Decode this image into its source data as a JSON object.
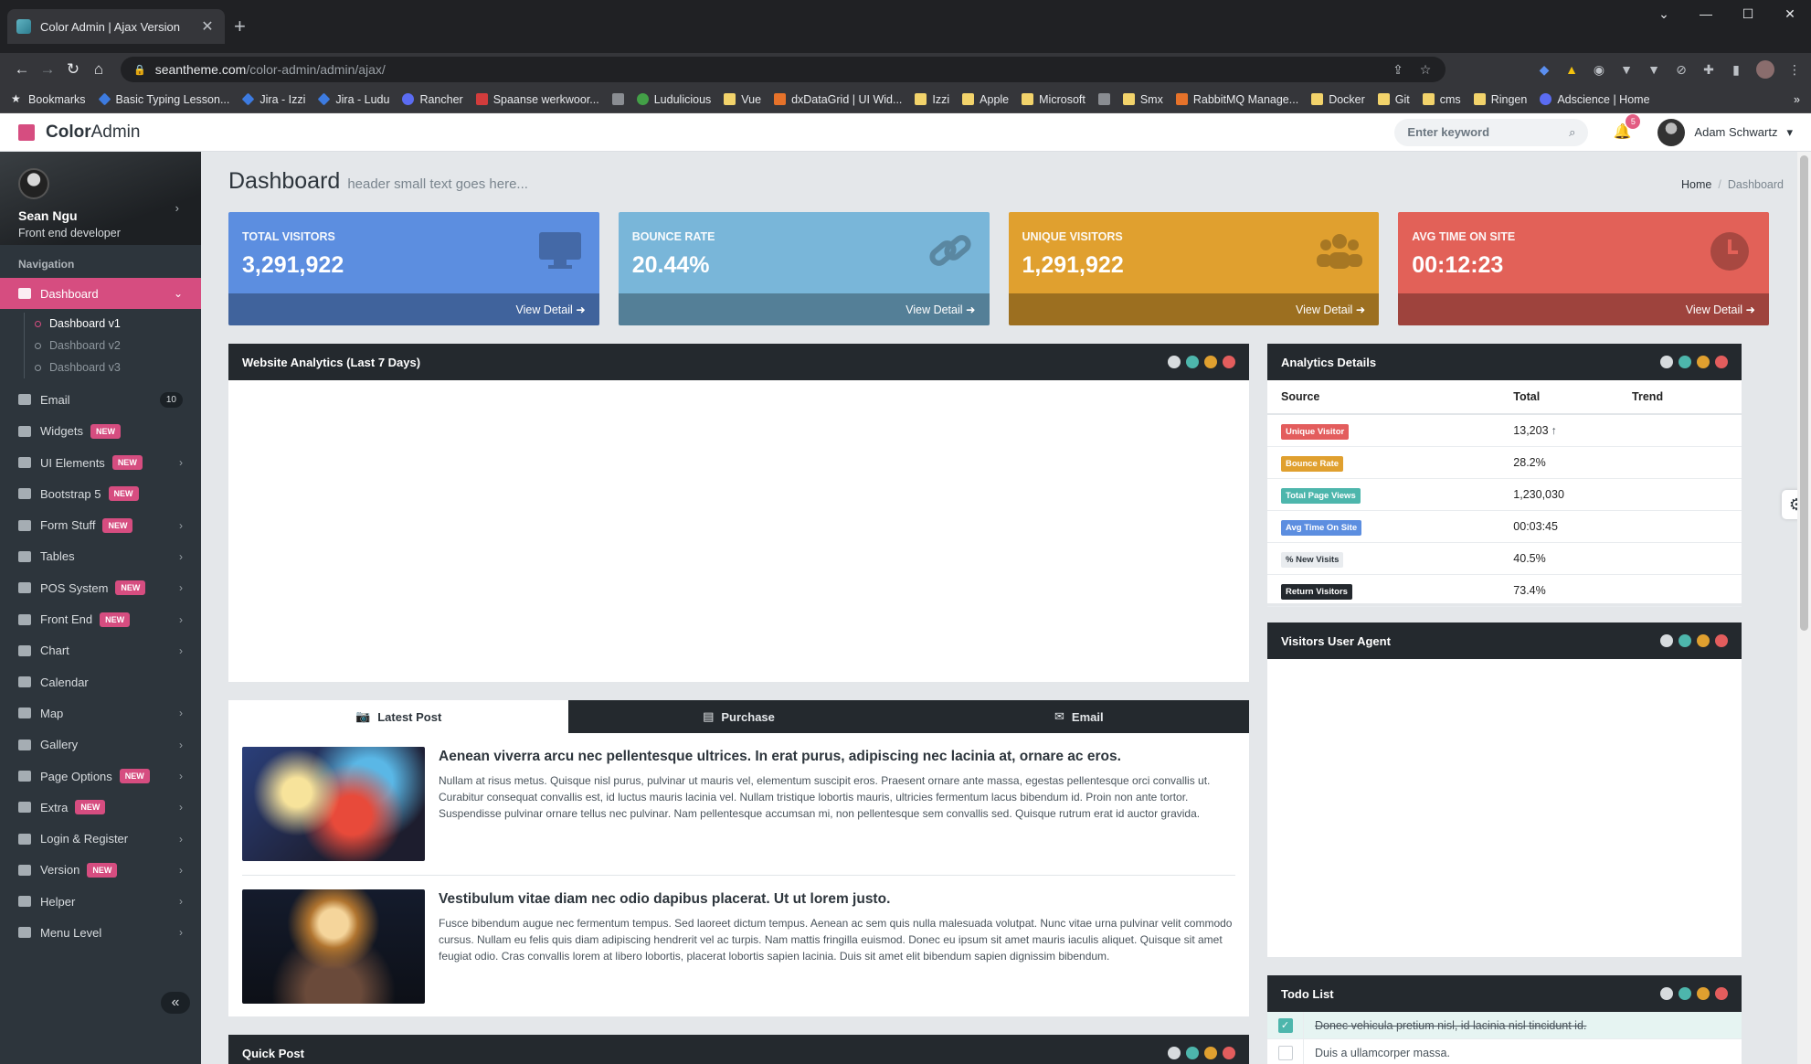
{
  "browser": {
    "tab_title": "Color Admin | Ajax Version",
    "url_host": "seantheme.com",
    "url_path": "/color-admin/admin/ajax/",
    "bookmarks": [
      {
        "label": "Bookmarks",
        "icon": "star-icon"
      },
      {
        "label": "Basic Typing Lesson...",
        "icon": "blue"
      },
      {
        "label": "Jira - Izzi",
        "icon": "blue"
      },
      {
        "label": "Jira - Ludu",
        "icon": "blue"
      },
      {
        "label": "Rancher",
        "icon": "purple"
      },
      {
        "label": "Spaanse werkwoor...",
        "icon": "red"
      },
      {
        "label": "",
        "icon": "gray"
      },
      {
        "label": "Ludulicious",
        "icon": "green"
      },
      {
        "label": "Vue",
        "icon": "folder"
      },
      {
        "label": "dxDataGrid | UI Wid...",
        "icon": "orange"
      },
      {
        "label": "Izzi",
        "icon": "folder"
      },
      {
        "label": "Apple",
        "icon": "folder"
      },
      {
        "label": "Microsoft",
        "icon": "folder"
      },
      {
        "label": "",
        "icon": "gray"
      },
      {
        "label": "Smx",
        "icon": "folder"
      },
      {
        "label": "RabbitMQ Manage...",
        "icon": "orange"
      },
      {
        "label": "Docker",
        "icon": "folder"
      },
      {
        "label": "Git",
        "icon": "folder"
      },
      {
        "label": "cms",
        "icon": "folder"
      },
      {
        "label": "Ringen",
        "icon": "folder"
      },
      {
        "label": "Adscience | Home",
        "icon": "purple"
      }
    ]
  },
  "topbar": {
    "brand_bold": "Color",
    "brand_rest": "Admin",
    "search_placeholder": "Enter keyword",
    "notif_count": "5",
    "user_name": "Adam Schwartz"
  },
  "sidebar": {
    "profile_name": "Sean Ngu",
    "profile_role": "Front end developer",
    "nav_header": "Navigation",
    "items": [
      {
        "label": "Dashboard",
        "active": true
      },
      {
        "label": "Email",
        "count": "10"
      },
      {
        "label": "Widgets",
        "badge": "NEW"
      },
      {
        "label": "UI Elements",
        "badge": "NEW",
        "caret": true
      },
      {
        "label": "Bootstrap 5",
        "badge": "NEW"
      },
      {
        "label": "Form Stuff",
        "badge": "NEW",
        "caret": true
      },
      {
        "label": "Tables",
        "caret": true
      },
      {
        "label": "POS System",
        "badge": "NEW",
        "caret": true
      },
      {
        "label": "Front End",
        "badge": "NEW",
        "caret": true
      },
      {
        "label": "Chart",
        "caret": true
      },
      {
        "label": "Calendar"
      },
      {
        "label": "Map",
        "caret": true
      },
      {
        "label": "Gallery",
        "caret": true
      },
      {
        "label": "Page Options",
        "badge": "NEW",
        "caret": true
      },
      {
        "label": "Extra",
        "badge": "NEW",
        "caret": true
      },
      {
        "label": "Login & Register",
        "caret": true
      },
      {
        "label": "Version",
        "badge": "NEW",
        "caret": true
      },
      {
        "label": "Helper",
        "caret": true
      },
      {
        "label": "Menu Level",
        "caret": true
      }
    ],
    "sub_items": [
      "Dashboard v1",
      "Dashboard v2",
      "Dashboard v3"
    ],
    "collapse_icon": "double-chevron-left-icon"
  },
  "page": {
    "title": "Dashboard",
    "subtitle": "header small text goes here...",
    "breadcrumb_home": "Home",
    "breadcrumb_current": "Dashboard"
  },
  "stats": [
    {
      "label": "TOTAL VISITORS",
      "value": "3,291,922",
      "link": "View Detail",
      "icon": "desktop-icon",
      "color": "#5c8ee0"
    },
    {
      "label": "BOUNCE RATE",
      "value": "20.44%",
      "link": "View Detail",
      "icon": "link-icon",
      "color": "#79b6d9"
    },
    {
      "label": "UNIQUE VISITORS",
      "value": "1,291,922",
      "link": "View Detail",
      "icon": "users-icon",
      "color": "#e0a02f"
    },
    {
      "label": "AVG TIME ON SITE",
      "value": "00:12:23",
      "link": "View Detail",
      "icon": "clock-icon",
      "color": "#e26158"
    }
  ],
  "analytics_panel": {
    "title": "Website Analytics (Last 7 Days)"
  },
  "details_panel": {
    "title": "Analytics Details",
    "headers": [
      "Source",
      "Total",
      "Trend"
    ],
    "rows": [
      {
        "source": "Unique Visitor",
        "total": "13,203",
        "color": "#e35d5d",
        "arrow": "↑"
      },
      {
        "source": "Bounce Rate",
        "total": "28.2%",
        "color": "#e0a02f",
        "arrow": ""
      },
      {
        "source": "Total Page Views",
        "total": "1,230,030",
        "color": "#4db6ac",
        "arrow": ""
      },
      {
        "source": "Avg Time On Site",
        "total": "00:03:45",
        "color": "#5c8ee0",
        "arrow": ""
      },
      {
        "source": "% New Visits",
        "total": "40.5%",
        "color": "#e9ecef",
        "arrow": ""
      },
      {
        "source": "Return Visitors",
        "total": "73.4%",
        "color": "#24292e",
        "arrow": ""
      }
    ]
  },
  "agent_panel": {
    "title": "Visitors User Agent"
  },
  "posts_tabs": [
    "Latest Post",
    "Purchase",
    "Email"
  ],
  "posts": [
    {
      "title": "Aenean viverra arcu nec pellentesque ultrices. In erat purus, adipiscing nec lacinia at, ornare ac eros.",
      "body": "Nullam at risus metus. Quisque nisl purus, pulvinar ut mauris vel, elementum suscipit eros. Praesent ornare ante massa, egestas pellentesque orci convallis ut. Curabitur consequat convallis est, id luctus mauris lacinia vel. Nullam tristique lobortis mauris, ultricies fermentum lacus bibendum id. Proin non ante tortor. Suspendisse pulvinar ornare tellus nec pulvinar. Nam pellentesque accumsan mi, non pellentesque sem convallis sed. Quisque rutrum erat id auctor gravida."
    },
    {
      "title": "Vestibulum vitae diam nec odio dapibus placerat. Ut ut lorem justo.",
      "body": "Fusce bibendum augue nec fermentum tempus. Sed laoreet dictum tempus. Aenean ac sem quis nulla malesuada volutpat. Nunc vitae urna pulvinar velit commodo cursus. Nullam eu felis quis diam adipiscing hendrerit vel ac turpis. Nam mattis fringilla euismod. Donec eu ipsum sit amet mauris iaculis aliquet. Quisque sit amet feugiat odio. Cras convallis lorem at libero lobortis, placerat lobortis sapien lacinia. Duis sit amet elit bibendum sapien dignissim bibendum."
    }
  ],
  "todo_panel": {
    "title": "Todo List",
    "items": [
      {
        "text": "Donec vehicula pretium nisl, id lacinia nisl tincidunt id.",
        "done": true
      },
      {
        "text": "Duis a ullamcorper massa.",
        "done": false
      }
    ]
  },
  "quickpost_panel": {
    "title": "Quick Post"
  }
}
